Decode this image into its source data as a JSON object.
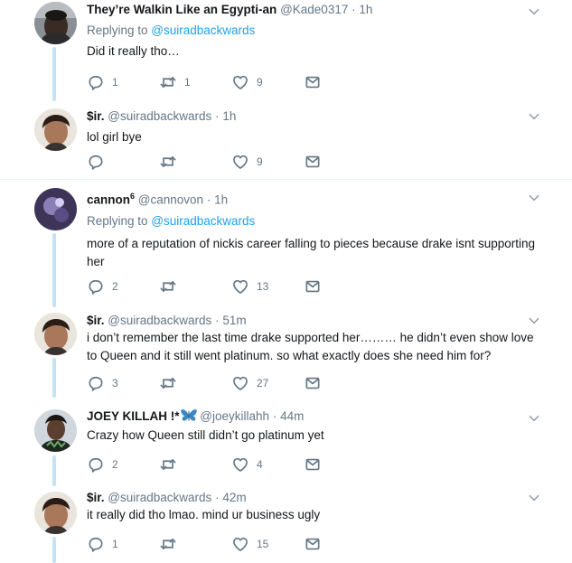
{
  "tweets": [
    {
      "name": "They’re Walkin Like an Egypti-an",
      "handle": "@Kade0317",
      "time": "1h",
      "replying_prefix": "Replying to ",
      "replying_to": "@suiradbackwards",
      "text": "Did it really tho…",
      "replies": "1",
      "retweets": "1",
      "likes": "9"
    },
    {
      "name": "$ir.",
      "handle": "@suiradbackwards",
      "time": "1h",
      "text": "lol girl bye",
      "replies": "",
      "retweets": "",
      "likes": "9"
    },
    {
      "name": "cannon",
      "name_sup": "6",
      "handle": "@cannovon",
      "time": "1h",
      "replying_prefix": "Replying to ",
      "replying_to": "@suiradbackwards",
      "text": "more of a reputation of nickis career falling to pieces because drake isnt supporting her",
      "replies": "2",
      "retweets": "",
      "likes": "13"
    },
    {
      "name": "$ir.",
      "handle": "@suiradbackwards",
      "time": "51m",
      "text": "i don’t remember the last time drake supported her……… he didn’t even show love to Queen and it still went platinum. so what exactly does she need him for?",
      "replies": "3",
      "retweets": "",
      "likes": "27"
    },
    {
      "name": "JOEY KILLAH !*",
      "handle": "@joeykillahh",
      "time": "44m",
      "text": "Crazy how Queen still didn’t go platinum yet",
      "replies": "2",
      "retweets": "",
      "likes": "4"
    },
    {
      "name": "$ir.",
      "handle": "@suiradbackwards",
      "time": "42m",
      "text": "it really did tho lmao. mind ur business ugly",
      "replies": "1",
      "retweets": "",
      "likes": "15"
    }
  ],
  "sep_dot": "·",
  "icons": [
    "reply-icon",
    "retweet-icon",
    "like-icon",
    "message-icon",
    "chevron-down-icon",
    "butterfly-icon"
  ],
  "colors": {
    "link": "#1da1f2",
    "muted": "#657786",
    "thread": "#c4e4f4",
    "border": "#e6ecf0"
  }
}
